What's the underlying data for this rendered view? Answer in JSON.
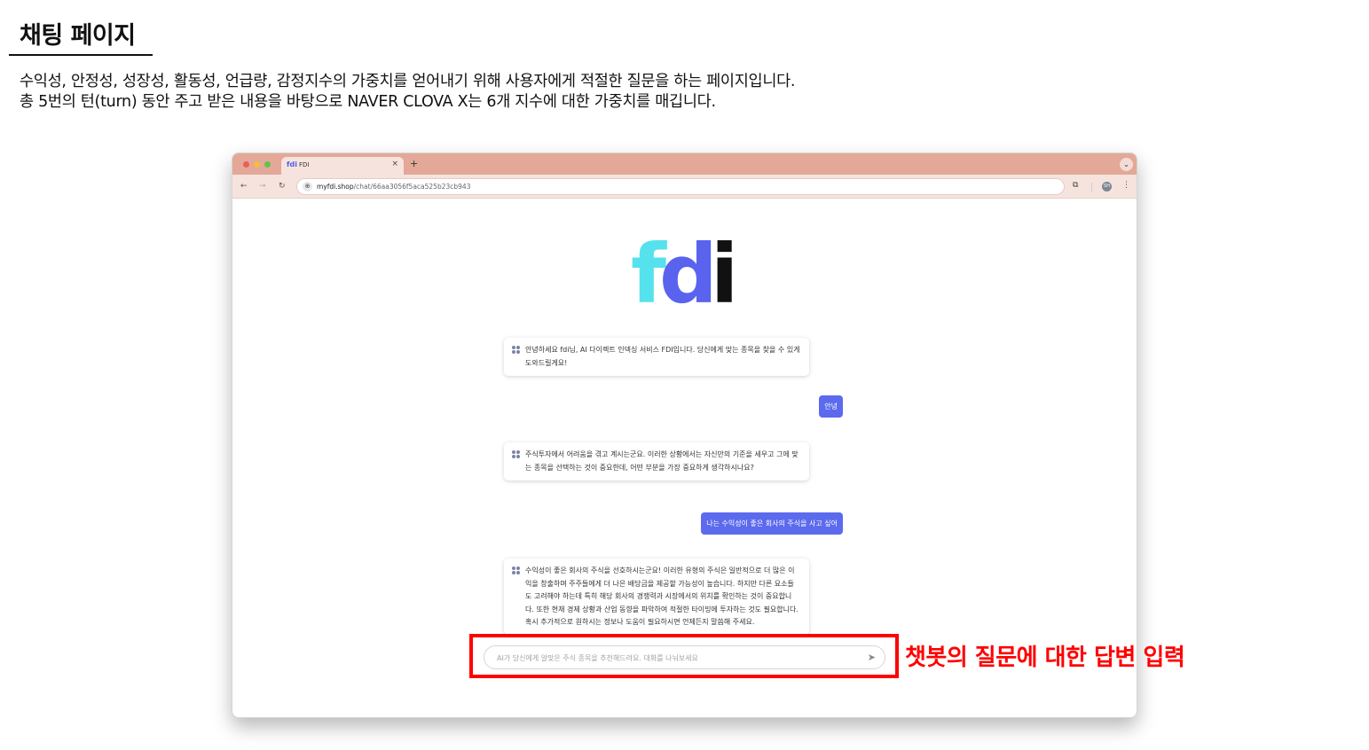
{
  "slide": {
    "title": "채팅 페이지",
    "description_line1": "수익성, 안정성, 성장성, 활동성, 언급량, 감정지수의 가중치를 얻어내기 위해 사용자에게 적절한 질문을 하는 페이지입니다.",
    "description_line2": "총 5번의 턴(turn) 동안 주고 받은 내용을 바탕으로 NAVER CLOVA X는 6개 지수에 대한 가중치를 매깁니다.",
    "annotation": "챗봇의 질문에 대한 답변 입력",
    "highlight_color": "#ff0000"
  },
  "browser": {
    "tab_title": "FDI",
    "tab_favicon": "fdi",
    "tab_close": "×",
    "new_tab": "+",
    "tab_menu": "⌄",
    "url_host": "myfdi.shop",
    "url_path": "/chat/66aa3056f5aca525b23cb943",
    "nav_back": "←",
    "nav_forward": "→",
    "nav_reload": "↻",
    "site_info_icon": "⊕",
    "extensions_icon": "⧉",
    "profile_initials": "SH",
    "more_icon": "⋮",
    "tabbar_color": "#e3a898"
  },
  "app": {
    "logo": {
      "f": "f",
      "d": "d",
      "i": "i"
    },
    "messages": [
      {
        "role": "bot",
        "text": "안녕하세요 fdi님, AI 다이렉트 인덱싱 서비스 FDI입니다. 당신에게 맞는 종목을 찾을 수 있게 도와드릴게요!"
      },
      {
        "role": "user",
        "text": "안녕"
      },
      {
        "role": "bot",
        "text": "주식투자에서 어려움을 겪고 계시는군요. 이러한 상황에서는 자신만의 기준을 세우고 그에 맞는 종목을 선택하는 것이 중요한데, 어떤 부분을 가장 중요하게 생각하시나요?"
      },
      {
        "role": "user",
        "text": "나는 수익성이 좋은 회사의 주식을 사고 싶어"
      },
      {
        "role": "bot",
        "text": "수익성이 좋은 회사의 주식을 선호하시는군요! 이러한 유형의 주식은 일반적으로 더 많은 이익을 창출하며 주주들에게 더 나은 배당금을 제공할 가능성이 높습니다. 하지만 다른 요소들도 고려해야 하는데 특히 해당 회사의 경쟁력과 시장에서의 위치를 확인하는 것이 중요합니다. 또한 현재 경제 상황과 산업 동향을 파악하여 적절한 타이밍에 투자하는 것도 필요합니다. 혹시 추가적으로 원하시는 정보나 도움이 필요하시면 언제든지 말씀해 주세요."
      }
    ],
    "input_placeholder": "AI가 당신에게 알맞은 주식 종목을 추천해드려요. 대화를 나눠보세요",
    "send_icon": "➤",
    "accent_color": "#5c6aed"
  }
}
